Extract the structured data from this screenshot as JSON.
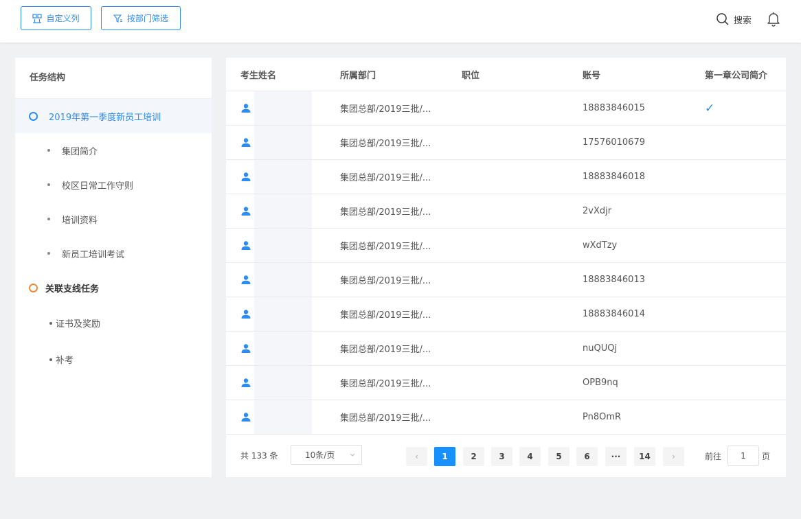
{
  "toolbar": {
    "custom_columns_label": "自定义列",
    "filter_by_dept_label": "按部门筛选",
    "search_label": "搜索"
  },
  "tree": {
    "title": "任务结构",
    "main_task": "2019年第一季度新员工培训",
    "main_children": [
      "集团简介",
      "校区日常工作守则",
      "培训资料",
      "新员工培训考试"
    ],
    "branch_task": "关联支线任务",
    "branch_children": [
      "证书及奖励",
      "补考"
    ]
  },
  "table": {
    "headers": [
      "考生姓名",
      "所属部门",
      "职位",
      "账号",
      "第一章公司简介"
    ],
    "rows": [
      {
        "dept": "集团总部/2019三批/...",
        "position": "",
        "account": "18883846015",
        "ch1": "✓"
      },
      {
        "dept": "集团总部/2019三批/...",
        "position": "",
        "account": "17576010679",
        "ch1": ""
      },
      {
        "dept": "集团总部/2019三批/...",
        "position": "",
        "account": "18883846018",
        "ch1": ""
      },
      {
        "dept": "集团总部/2019三批/...",
        "position": "",
        "account": "2vXdjr",
        "ch1": ""
      },
      {
        "dept": "集团总部/2019三批/...",
        "position": "",
        "account": "wXdTzy",
        "ch1": ""
      },
      {
        "dept": "集团总部/2019三批/...",
        "position": "",
        "account": "18883846013",
        "ch1": ""
      },
      {
        "dept": "集团总部/2019三批/...",
        "position": "",
        "account": "18883846014",
        "ch1": ""
      },
      {
        "dept": "集团总部/2019三批/...",
        "position": "",
        "account": "nuQUQj",
        "ch1": ""
      },
      {
        "dept": "集团总部/2019三批/...",
        "position": "",
        "account": "OPB9nq",
        "ch1": ""
      },
      {
        "dept": "集团总部/2019三批/...",
        "position": "",
        "account": "Pn8OmR",
        "ch1": ""
      }
    ]
  },
  "pagination": {
    "total_text": "共 133 条",
    "page_size": "10条/页",
    "pages": [
      "1",
      "2",
      "3",
      "4",
      "5",
      "6",
      "···",
      "14"
    ],
    "current_page": "1",
    "goto_prefix": "前往",
    "goto_value": "1",
    "goto_suffix": "页",
    "prev_symbol": "‹",
    "next_symbol": "›"
  },
  "colors": {
    "accent": "#2d8cf0",
    "branch_ring": "#f0883a",
    "active_page": "#1890ff"
  }
}
